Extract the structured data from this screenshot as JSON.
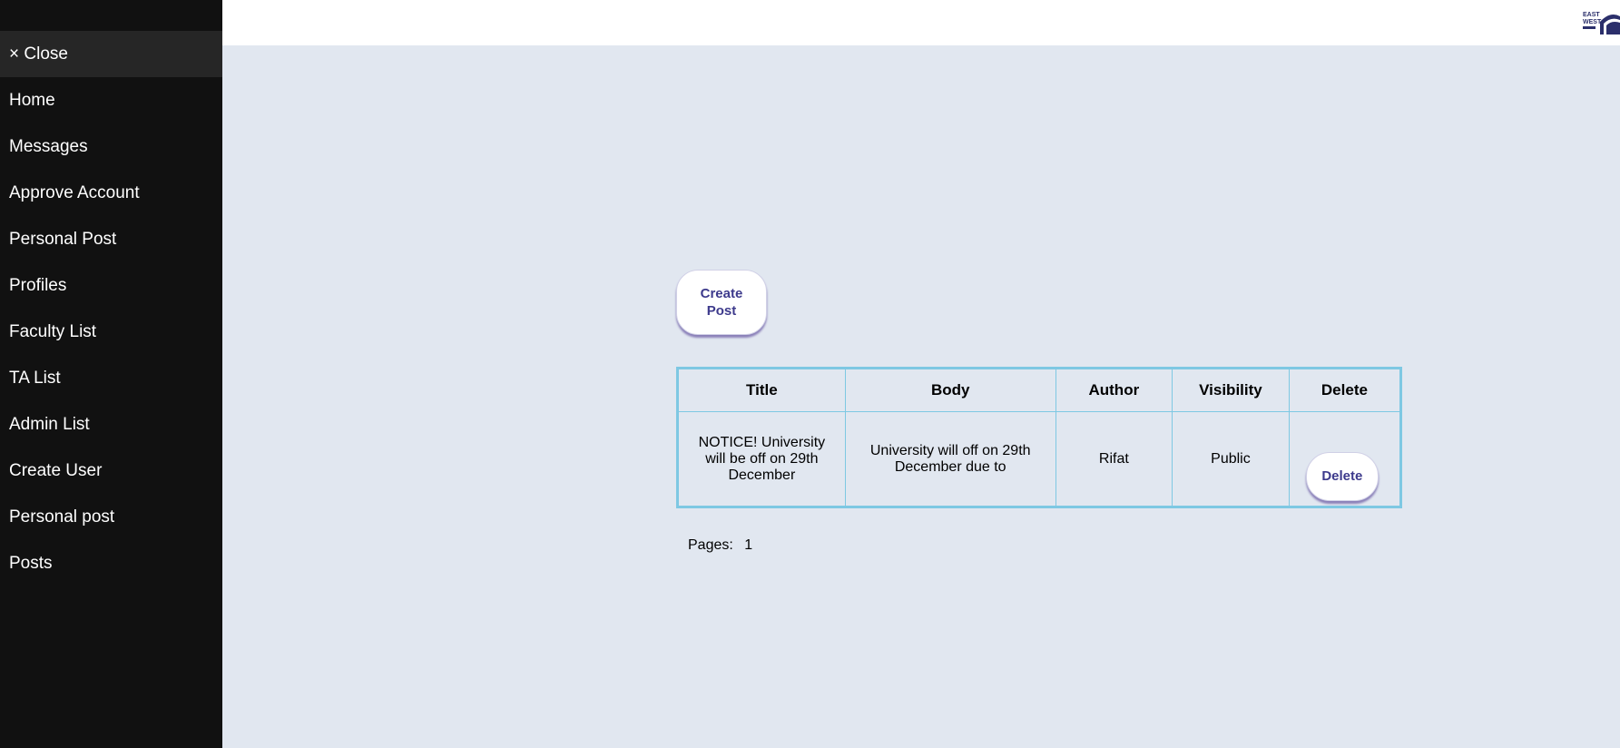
{
  "sidebar": {
    "close_label": "× Close",
    "items": [
      {
        "label": "Home"
      },
      {
        "label": "Messages"
      },
      {
        "label": "Approve Account"
      },
      {
        "label": "Personal Post"
      },
      {
        "label": "Profiles"
      },
      {
        "label": "Faculty List"
      },
      {
        "label": "TA List"
      },
      {
        "label": "Admin List"
      },
      {
        "label": "Create User"
      },
      {
        "label": "Personal post"
      },
      {
        "label": "Posts"
      }
    ]
  },
  "header": {
    "logo_text": "EAST WEST UNIVERSITY"
  },
  "main": {
    "create_post_label": "Create\nPost",
    "table": {
      "headers": [
        "Title",
        "Body",
        "Author",
        "Visibility",
        "Delete"
      ],
      "rows": [
        {
          "title": "NOTICE! University will be off on 29th December",
          "body": "University will off on 29th December due to",
          "author": "Rifat",
          "visibility": "Public",
          "delete_label": "Delete"
        }
      ]
    },
    "pagination": {
      "label": "Pages:",
      "pages": [
        "1"
      ]
    }
  },
  "colors": {
    "sidebar_bg": "#111111",
    "page_bg": "#e1e7f0",
    "table_border": "#7ec8e3",
    "button_text": "#3d3a8c"
  }
}
